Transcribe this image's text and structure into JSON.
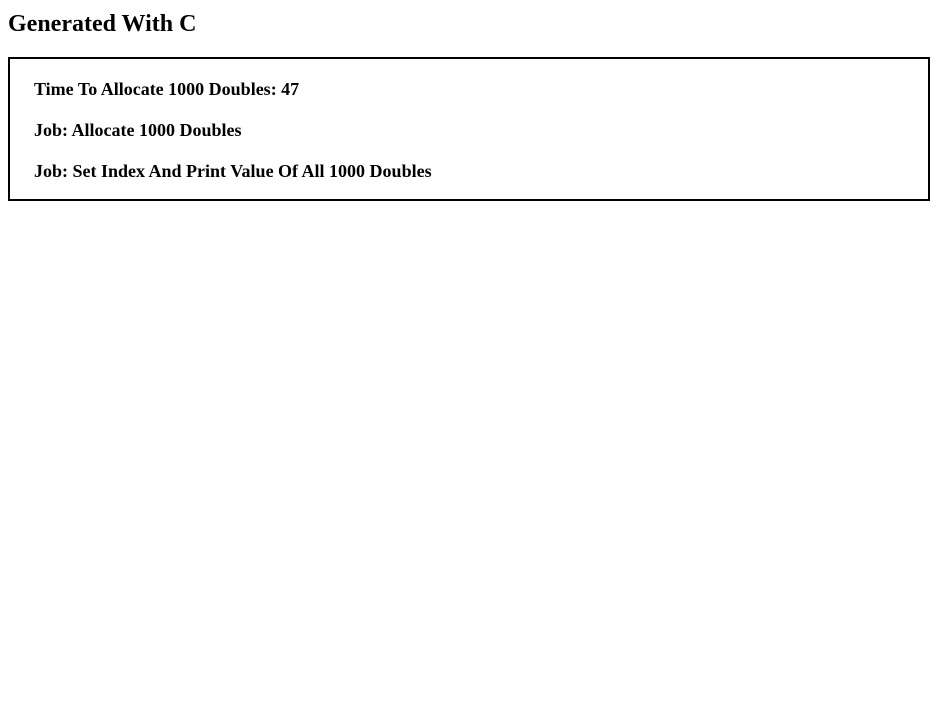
{
  "page": {
    "title": "Generated With C"
  },
  "info_box": {
    "lines": [
      "Time To Allocate 1000 Doubles: 47",
      "Job: Allocate 1000 Doubles",
      "Job: Set Index And Print Value Of All 1000 Doubles"
    ]
  }
}
